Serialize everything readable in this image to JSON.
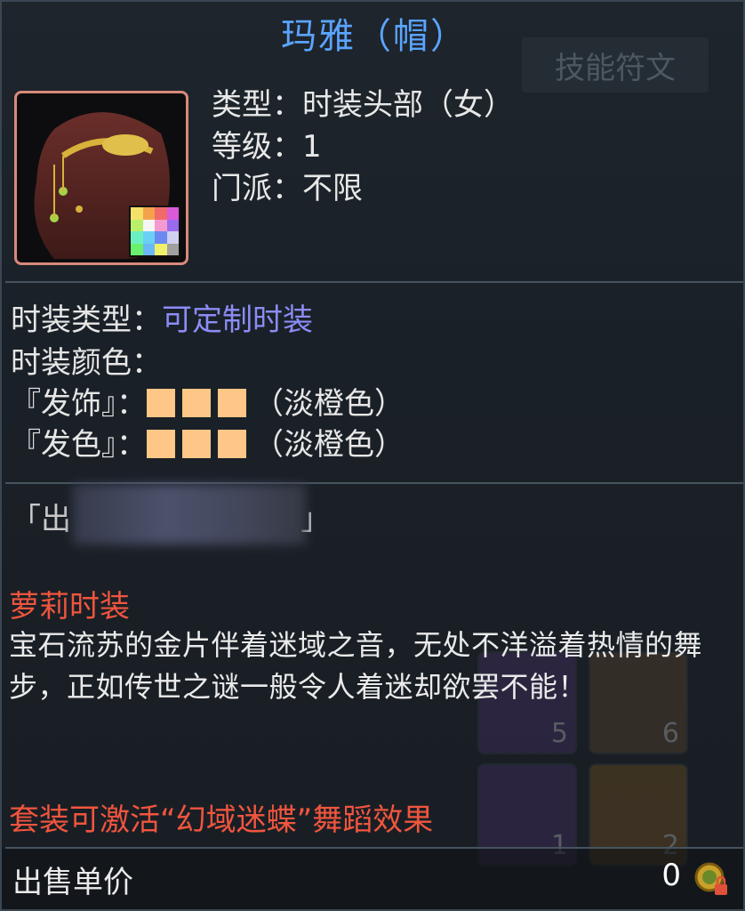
{
  "item": {
    "title": "玛雅（帽）",
    "type_line": "类型：时装头部（女）",
    "level_line": "等级：1",
    "faction_line": "门派：不限"
  },
  "background": {
    "tab_label": "技能符文",
    "slot_numbers": [
      "5",
      "6",
      "1",
      "2"
    ]
  },
  "fashion": {
    "type_label": "时装类型：",
    "type_value": "可定制时装",
    "color_label": "时装颜色：",
    "hair_ornament_label": "『发饰』：",
    "hair_ornament_color": "（淡橙色）",
    "hair_color_label": "『发色』：",
    "hair_color_color": "（淡橙色）",
    "swatch_color": "#ffc787"
  },
  "source": {
    "prefix": "「出",
    "suffix": "」"
  },
  "lore": {
    "heading": "萝莉时装",
    "text": "宝石流苏的金片伴着迷域之音，无处不洋溢着热情的舞步，正如传世之谜一般令人着迷却欲罢不能！",
    "set_effect": "套装可激活“幻域迷蝶”舞蹈效果"
  },
  "footer": {
    "sell_label": "出售单价",
    "price": "0"
  },
  "icons": {
    "item_icon": "hair-accessory-icon",
    "palette_icon": "color-palette-icon",
    "coin_icon": "coin-lock-icon"
  }
}
